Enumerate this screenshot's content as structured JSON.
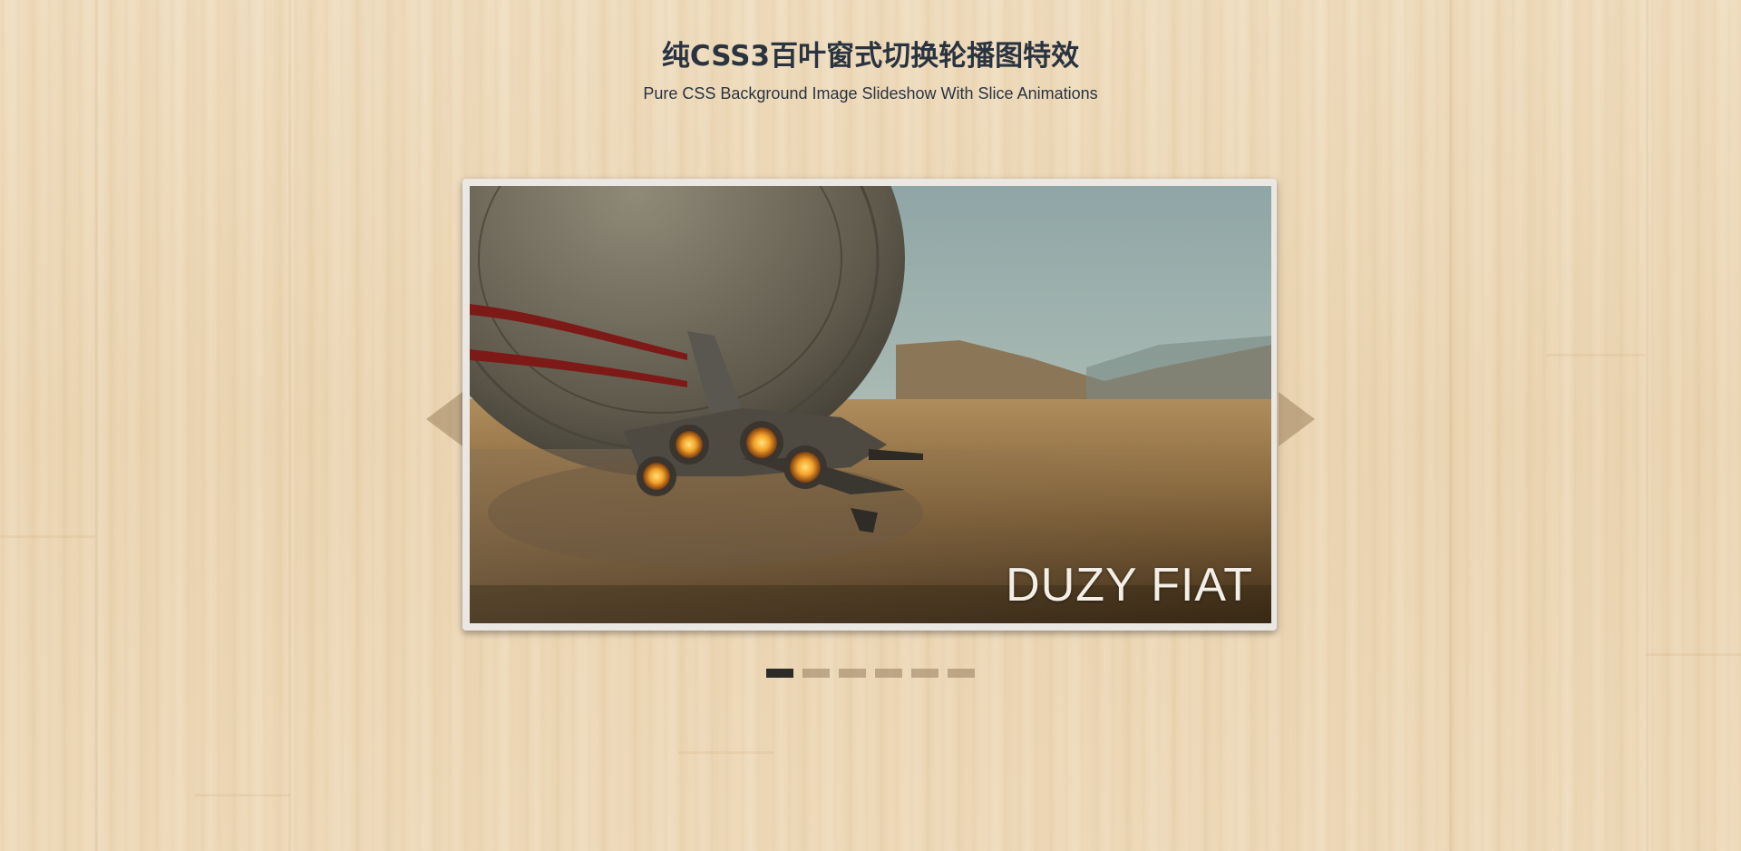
{
  "header": {
    "title": "纯CSS3百叶窗式切换轮播图特效",
    "subtitle": "Pure CSS Background Image Slideshow With Slice Animations"
  },
  "slider": {
    "current_caption": "DUZY FIAT",
    "slide_count": 6,
    "active_index": 0,
    "prev_icon": "arrow-left-icon",
    "next_icon": "arrow-right-icon"
  },
  "colors": {
    "background": "#ecd8b8",
    "title": "#2a3340",
    "frame": "#ebe7e2",
    "dot_active": "#2d2b28",
    "dot_inactive": "#b7a58a"
  }
}
